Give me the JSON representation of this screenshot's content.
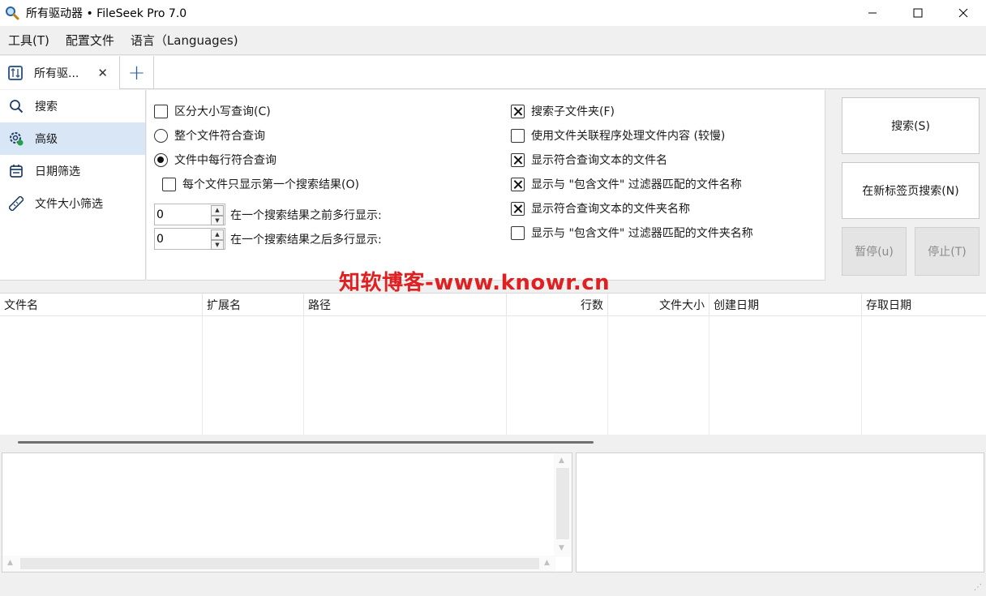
{
  "window": {
    "title": "所有驱动器 • FileSeek Pro 7.0",
    "app_icon": "magnifier-icon",
    "controls": {
      "minimize": "—",
      "maximize": "☐",
      "close": "✕"
    }
  },
  "menubar": {
    "items": [
      "工具(T)",
      "配置文件",
      "语言（Languages)"
    ]
  },
  "tabs": {
    "items": [
      {
        "label": "所有驱...",
        "close": "✕"
      }
    ],
    "add": "+"
  },
  "sidebar": {
    "items": [
      {
        "label": "搜索",
        "icon": "search-icon"
      },
      {
        "label": "高级",
        "icon": "gear-icon",
        "active": true
      },
      {
        "label": "日期筛选",
        "icon": "calendar-icon"
      },
      {
        "label": "文件大小筛选",
        "icon": "ruler-icon"
      }
    ]
  },
  "options": {
    "case_sensitive": {
      "label": "区分大小写查询(C)",
      "checked": false
    },
    "match_whole_file": {
      "label": "整个文件符合查询",
      "selected": false
    },
    "match_each_line": {
      "label": "文件中每行符合查询",
      "selected": true
    },
    "first_result_only": {
      "label": "每个文件只显示第一个搜索结果(O)",
      "checked": false
    },
    "lines_before": {
      "value": "0",
      "label": "在一个搜索结果之前多行显示:"
    },
    "lines_after": {
      "value": "0",
      "label": "在一个搜索结果之后多行显示:"
    },
    "search_subfolders": {
      "label": "搜索子文件夹(F)",
      "checked": true
    },
    "use_file_assoc": {
      "label": "使用文件关联程序处理文件内容 (较慢)",
      "checked": false
    },
    "show_matching_filenames": {
      "label": "显示符合查询文本的文件名",
      "checked": true
    },
    "show_include_filter_filenames": {
      "label": "显示与 \"包含文件\" 过滤器匹配的文件名称",
      "checked": true
    },
    "show_matching_foldernames": {
      "label": "显示符合查询文本的文件夹名称",
      "checked": true
    },
    "show_include_filter_foldernames": {
      "label": "显示与 \"包含文件\" 过滤器匹配的文件夹名称",
      "checked": false
    }
  },
  "actions": {
    "search": "搜索(S)",
    "search_new_tab": "在新标签页搜索(N)",
    "pause": "暂停(u)",
    "stop": "停止(T)"
  },
  "watermark": "知软博客-www.knowr.cn",
  "results": {
    "columns": [
      {
        "label": "文件名",
        "align": "left"
      },
      {
        "label": "扩展名",
        "align": "left"
      },
      {
        "label": "路径",
        "align": "left"
      },
      {
        "label": "行数",
        "align": "right"
      },
      {
        "label": "文件大小",
        "align": "right"
      },
      {
        "label": "创建日期",
        "align": "left"
      },
      {
        "label": "存取日期",
        "align": "left"
      }
    ],
    "rows": []
  },
  "colors": {
    "accent": "#2a5fa0",
    "active_nav": "#d9e6f6",
    "watermark": "#e02020"
  }
}
